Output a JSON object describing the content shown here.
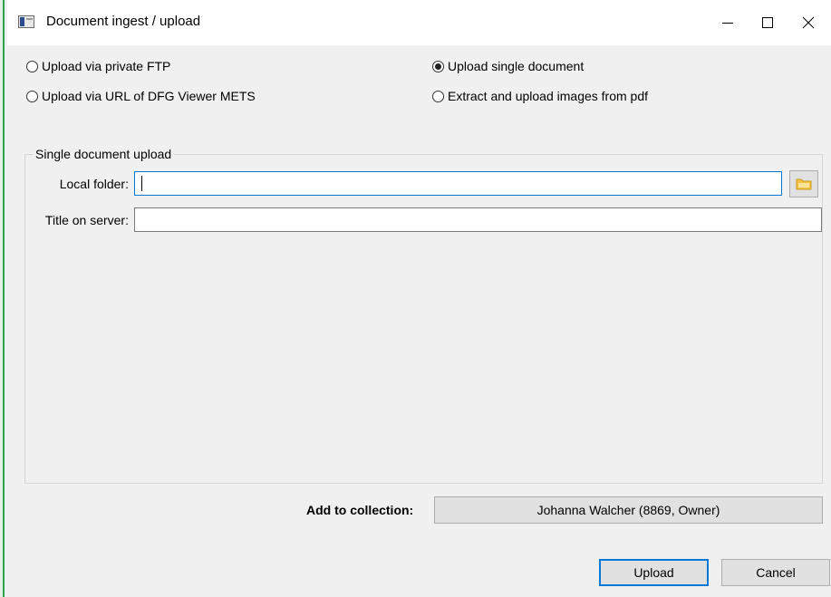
{
  "window": {
    "title": "Document ingest / upload",
    "minimize_glyph": "—",
    "maximize_glyph": "☐",
    "close_glyph": "✕"
  },
  "options": [
    {
      "label": "Upload via private FTP",
      "checked": false
    },
    {
      "label": "Upload via URL of DFG Viewer METS",
      "checked": false
    },
    {
      "label": "Upload single document",
      "checked": true
    },
    {
      "label": "Extract and upload images from pdf",
      "checked": false
    }
  ],
  "group": {
    "title": "Single document upload",
    "local_folder_label": "Local folder:",
    "local_folder_value": "",
    "title_label": "Title on server:",
    "title_value": ""
  },
  "collection": {
    "label": "Add to collection:",
    "value": "Johanna Walcher  (8869, Owner)"
  },
  "buttons": {
    "upload": "Upload",
    "cancel": "Cancel"
  },
  "colors": {
    "accent": "#0078d7",
    "edge": "#2aa44a",
    "folder": "#f5c242"
  }
}
